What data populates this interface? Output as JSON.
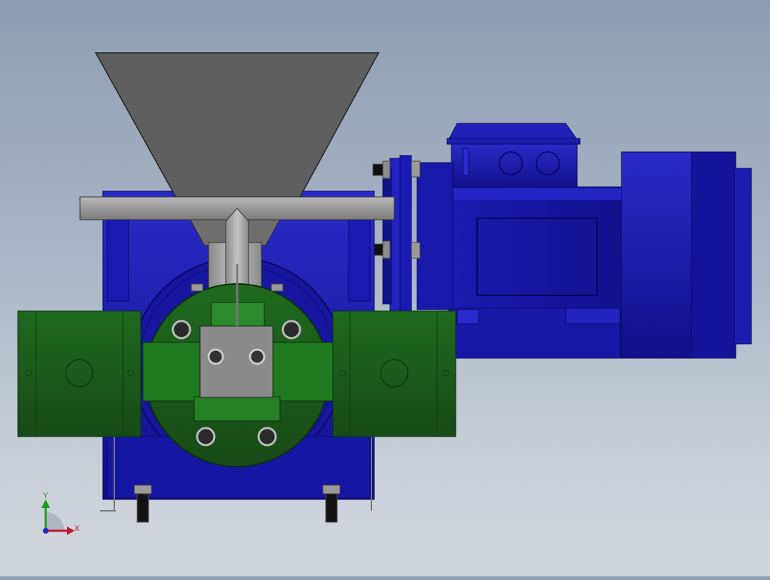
{
  "viewport": {
    "background_top": "#8e9eb2",
    "background_bottom": "#d2d6dc"
  },
  "model": {
    "parts": [
      {
        "name": "hopper",
        "color": "#5f5f5f"
      },
      {
        "name": "horizontal-pipe",
        "color": "#9a9a9a"
      },
      {
        "name": "gear-housing",
        "color": "#1d1ea8"
      },
      {
        "name": "motor-housing",
        "color": "#1a1aa0"
      },
      {
        "name": "pump-body",
        "color": "#1f5a1f"
      },
      {
        "name": "center-block",
        "color": "#8a8a8a"
      }
    ]
  },
  "triad": {
    "x_label": "X",
    "y_label": "Y",
    "x_color": "#c0152a",
    "y_color": "#18a018",
    "z_color": "#1a2ac8"
  }
}
